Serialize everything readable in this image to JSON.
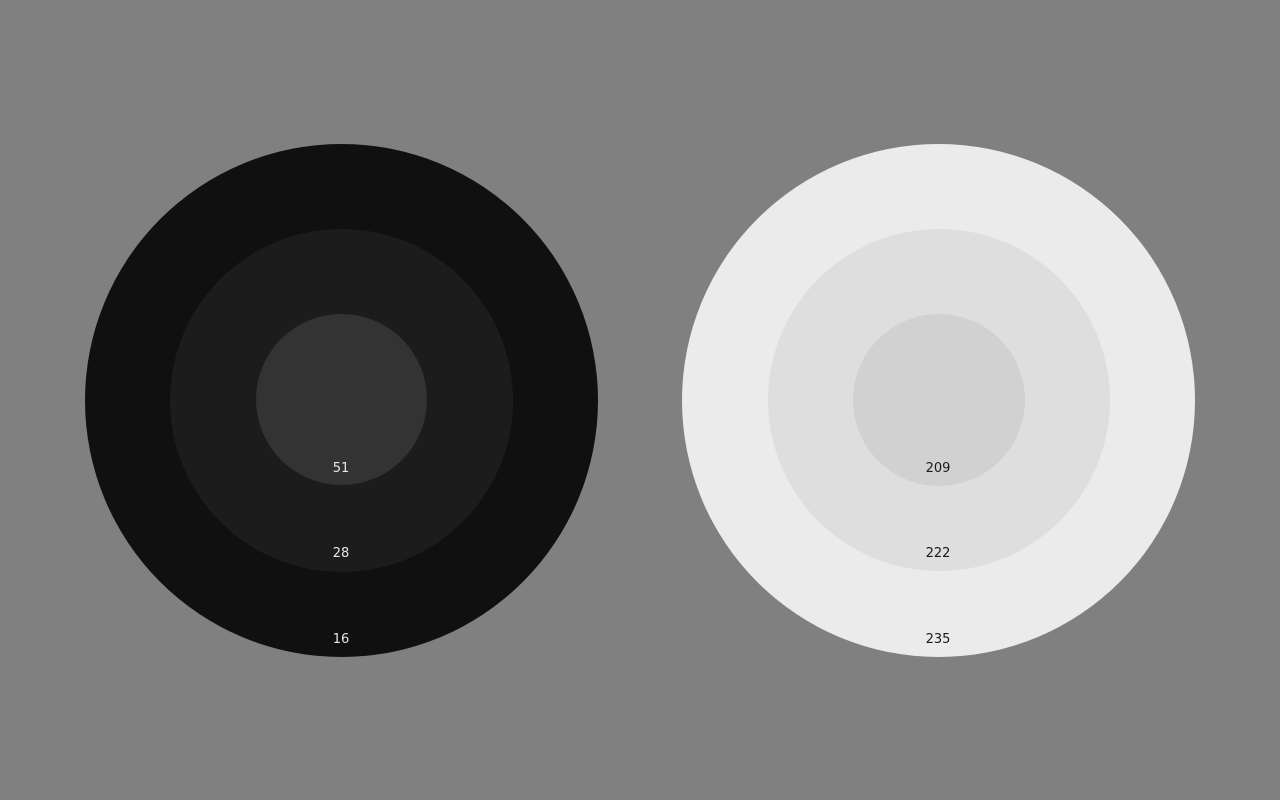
{
  "background": "#808080",
  "left_target": {
    "outer": {
      "label": "16",
      "color": "#101010",
      "label_color": "#e6e6e6"
    },
    "middle": {
      "label": "28",
      "color": "#1c1c1c",
      "label_color": "#e6e6e6"
    },
    "inner": {
      "label": "51",
      "color": "#333333",
      "label_color": "#e6e6e6"
    }
  },
  "right_target": {
    "outer": {
      "label": "235",
      "color": "#ebebeb",
      "label_color": "#1a1a1a"
    },
    "middle": {
      "label": "222",
      "color": "#dedede",
      "label_color": "#1a1a1a"
    },
    "inner": {
      "label": "209",
      "color": "#d1d1d1",
      "label_color": "#1a1a1a"
    }
  }
}
